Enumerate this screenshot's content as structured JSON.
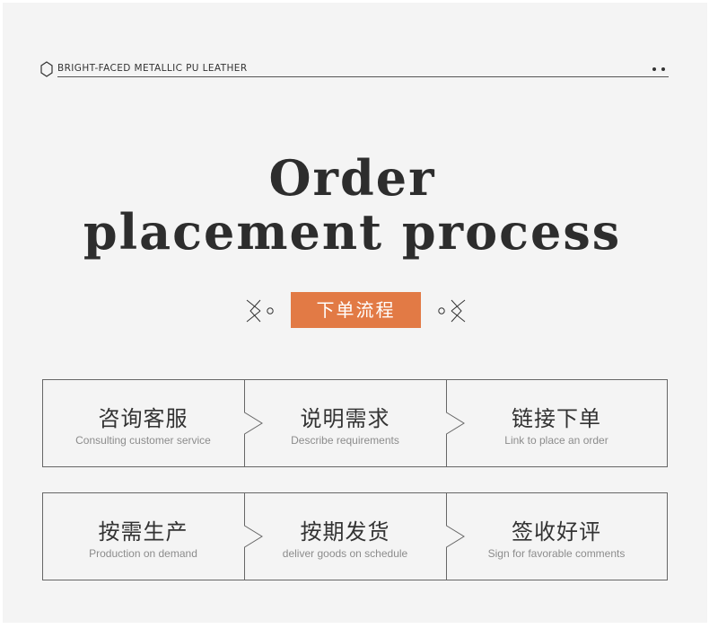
{
  "header": {
    "label": "BRIGHT-FACED METALLIC PU LEATHER"
  },
  "title": {
    "line1": "Order",
    "line2": "placement process"
  },
  "badge": {
    "label": "下单流程",
    "color": "#e27a45"
  },
  "steps": [
    {
      "cn": "咨询客服",
      "en": "Consulting customer service"
    },
    {
      "cn": "说明需求",
      "en": "Describe requirements"
    },
    {
      "cn": "链接下单",
      "en": "Link to place an order"
    },
    {
      "cn": "按需生产",
      "en": "Production on demand"
    },
    {
      "cn": "按期发货",
      "en": "deliver goods on schedule"
    },
    {
      "cn": "签收好评",
      "en": "Sign for favorable comments"
    }
  ]
}
